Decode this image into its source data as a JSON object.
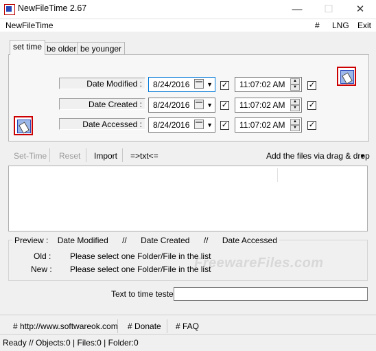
{
  "window": {
    "title": "NewFileTime 2.67",
    "minimize": "—",
    "maximize": "☐",
    "close": "✕"
  },
  "menubar": {
    "app": "NewFileTime",
    "hash": "#",
    "lng": "LNG",
    "exit": "Exit"
  },
  "tabs": [
    {
      "label": "set time",
      "active": true
    },
    {
      "label": "be older",
      "active": false
    },
    {
      "label": "be younger",
      "active": false
    }
  ],
  "rows": [
    {
      "label": "Date Modified :",
      "date": "8/24/2016",
      "time": "11:07:02 AM",
      "date_checked": true,
      "time_checked": true
    },
    {
      "label": "Date Created :",
      "date": "8/24/2016",
      "time": "11:07:02 AM",
      "date_checked": true,
      "time_checked": true
    },
    {
      "label": "Date Accessed :",
      "date": "8/24/2016",
      "time": "11:07:02 AM",
      "date_checked": true,
      "time_checked": true
    }
  ],
  "toolbar": {
    "set_time": "Set-Time",
    "reset": "Reset",
    "import": "Import",
    "txt": "=>txt<=",
    "add_files": "Add the files via drag & drop"
  },
  "preview": {
    "label": "Preview :",
    "modified": "Date Modified",
    "sep1": "//",
    "created": "Date Created",
    "sep2": "//",
    "accessed": "Date Accessed",
    "old_label": "Old :",
    "old_value": "Please select one Folder/File in the list",
    "new_label": "New :",
    "new_value": "Please select one Folder/File in the list"
  },
  "watermark": "FreewareFiles.com",
  "tester": {
    "label": "Text to time tester",
    "value": ""
  },
  "links": {
    "website": "# http://www.softwareok.com",
    "donate": "# Donate",
    "faq": "# FAQ"
  },
  "status": "Ready // Objects:0 | Files:0  | Folder:0"
}
